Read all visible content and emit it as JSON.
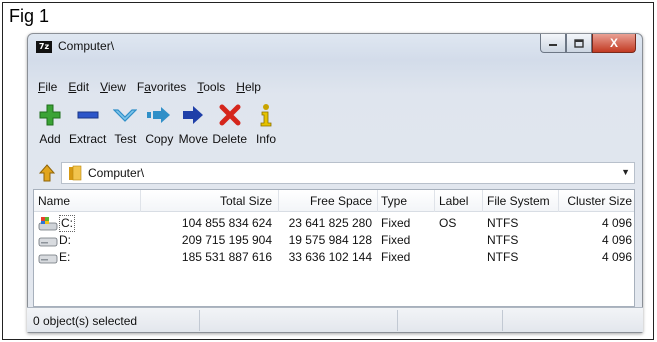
{
  "figure": {
    "label": "Fig 1"
  },
  "window": {
    "app_icon": "7z",
    "title": "Computer\\",
    "controls": {
      "minimize": "–",
      "maximize": "□",
      "close": "X"
    }
  },
  "menu": [
    {
      "label": "File",
      "u": "F",
      "rest": "ile"
    },
    {
      "label": "Edit",
      "u": "E",
      "rest": "dit"
    },
    {
      "label": "View",
      "u": "V",
      "rest": "iew"
    },
    {
      "label": "Favorites",
      "u": "Fa",
      "pre": "F",
      "ul": "a",
      "rest": "vorites"
    },
    {
      "label": "Tools",
      "u": "T",
      "rest": "ools"
    },
    {
      "label": "Help",
      "u": "H",
      "rest": "elp"
    }
  ],
  "toolbar": {
    "add": "Add",
    "extract": "Extract",
    "test": "Test",
    "copy": "Copy",
    "move": "Move",
    "delete": "Delete",
    "info": "Info"
  },
  "address": {
    "path": "Computer\\"
  },
  "table": {
    "columns": [
      "Name",
      "Total Size",
      "Free Space",
      "Type",
      "Label",
      "File System",
      "Cluster Size"
    ],
    "rows": [
      {
        "name": "C:",
        "total": "104 855 834 624",
        "free": "23 641 825 280",
        "type": "Fixed",
        "label": "OS",
        "fs": "NTFS",
        "cluster": "4 096",
        "icon": "system-drive-icon"
      },
      {
        "name": "D:",
        "total": "209 715 195 904",
        "free": "19 575 984 128",
        "type": "Fixed",
        "label": "",
        "fs": "NTFS",
        "cluster": "4 096",
        "icon": "hard-drive-icon"
      },
      {
        "name": "E:",
        "total": "185 531 887 616",
        "free": "33 636 102 144",
        "type": "Fixed",
        "label": "",
        "fs": "NTFS",
        "cluster": "4 096",
        "icon": "hard-drive-icon"
      }
    ]
  },
  "status": {
    "selection": "0 object(s) selected"
  },
  "colors": {
    "add": "#3aa335",
    "extract": "#2c55c9",
    "test": "#2f8fc8",
    "copy": "#2f8fc8",
    "move": "#1f3fa8",
    "delete": "#d5261c",
    "info": "#c9a400",
    "close_button": "#c23a22"
  }
}
